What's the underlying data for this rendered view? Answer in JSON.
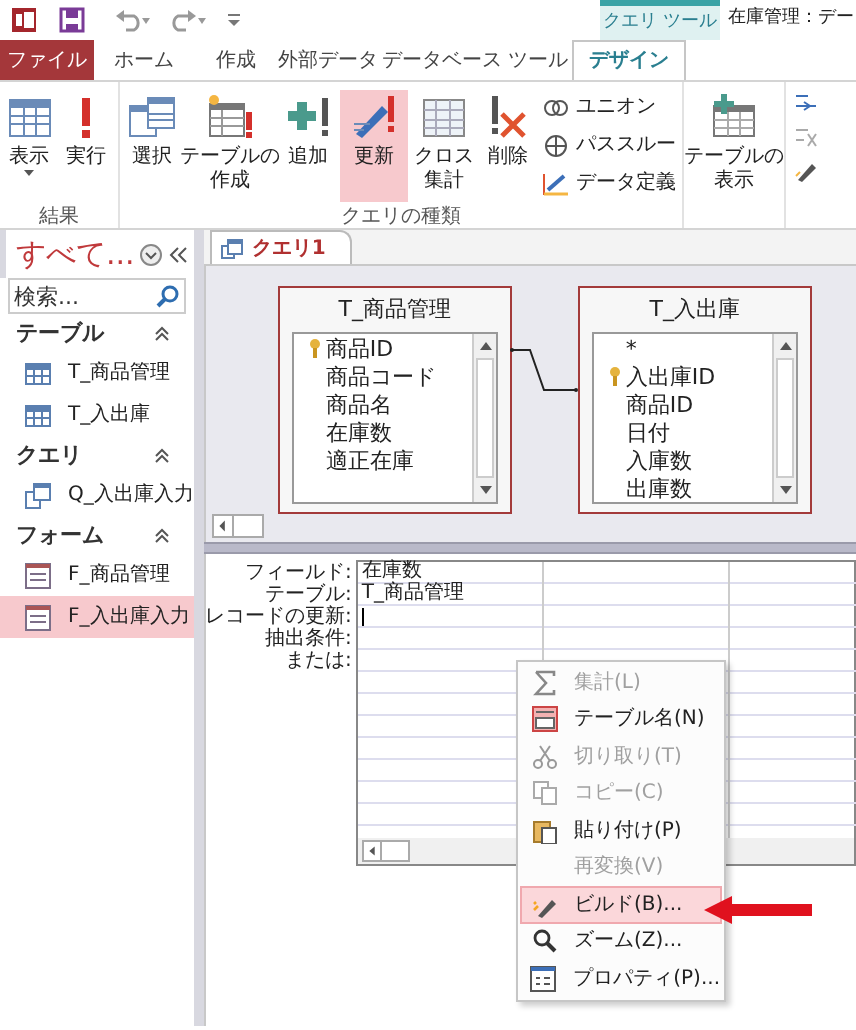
{
  "window": {
    "tool_tab": "クエリ ツール",
    "title": "在庫管理：デー"
  },
  "tabs": [
    {
      "label": "ファイル",
      "kind": "file",
      "selected": false
    },
    {
      "label": "ホーム",
      "kind": "tab",
      "selected": false
    },
    {
      "label": "作成",
      "kind": "tab",
      "selected": false
    },
    {
      "label": "外部データ",
      "kind": "tab",
      "selected": false
    },
    {
      "label": "データベース ツール",
      "kind": "tab",
      "selected": false
    },
    {
      "label": "デザイン",
      "kind": "tab",
      "selected": true
    }
  ],
  "ribbon": {
    "groups": [
      {
        "label": "結果",
        "buttons": [
          {
            "label": "表示",
            "kind": "big",
            "dropdown": true,
            "selected": false
          },
          {
            "label": "実行",
            "kind": "big",
            "selected": false
          }
        ]
      },
      {
        "label": "クエリの種類",
        "buttons": [
          {
            "label": "選択",
            "kind": "big",
            "selected": false
          },
          {
            "label": [
              "テーブルの",
              "作成"
            ],
            "kind": "big",
            "selected": false
          },
          {
            "label": "追加",
            "kind": "big",
            "selected": false
          },
          {
            "label": "更新",
            "kind": "big",
            "selected": true
          },
          {
            "label": [
              "クロス",
              "集計"
            ],
            "kind": "big",
            "selected": false
          },
          {
            "label": "削除",
            "kind": "big",
            "selected": false
          },
          {
            "label": "ユニオン",
            "kind": "small",
            "selected": false
          },
          {
            "label": "パススルー",
            "kind": "small",
            "selected": false
          },
          {
            "label": "データ定義",
            "kind": "small",
            "selected": false
          }
        ]
      },
      {
        "buttons": [
          {
            "label": [
              "テーブルの",
              "表示"
            ],
            "kind": "big",
            "selected": false
          }
        ]
      }
    ]
  },
  "navigation": {
    "title": "すべて...",
    "search": {
      "placeholder": "検索..."
    },
    "sections": [
      {
        "label": "テーブル",
        "expanded": true,
        "items": [
          {
            "label": "T_商品管理",
            "kind": "table",
            "selected": false
          },
          {
            "label": "T_入出庫",
            "kind": "table",
            "selected": false
          }
        ]
      },
      {
        "label": "クエリ",
        "expanded": true,
        "items": [
          {
            "label": "Q_入出庫入力",
            "kind": "query",
            "selected": false
          }
        ]
      },
      {
        "label": "フォーム",
        "expanded": true,
        "items": [
          {
            "label": "F_商品管理",
            "kind": "form",
            "selected": false
          },
          {
            "label": "F_入出庫入力",
            "kind": "form",
            "selected": true
          }
        ]
      }
    ]
  },
  "document_tab": {
    "label": "クエリ1"
  },
  "tables": [
    {
      "title": "T_商品管理",
      "fields": [
        {
          "name": "商品ID",
          "key": true
        },
        {
          "name": "商品コード",
          "key": false
        },
        {
          "name": "商品名",
          "key": false
        },
        {
          "name": "在庫数",
          "key": false
        },
        {
          "name": "適正在庫",
          "key": false
        }
      ]
    },
    {
      "title": "T_入出庫",
      "fields": [
        {
          "name": "*",
          "key": false
        },
        {
          "name": "入出庫ID",
          "key": true
        },
        {
          "name": "商品ID",
          "key": false
        },
        {
          "name": "日付",
          "key": false
        },
        {
          "name": "入庫数",
          "key": false
        },
        {
          "name": "出庫数",
          "key": false
        }
      ]
    }
  ],
  "grid": {
    "row_labels": [
      "フィールド:",
      "テーブル:",
      "レコードの更新:",
      "抽出条件:",
      "または:"
    ],
    "columns": [
      {
        "field": "在庫数",
        "table": "T_商品管理",
        "editing": true
      }
    ]
  },
  "context_menu": [
    {
      "label": "集計(L)",
      "disabled": true,
      "selected": false
    },
    {
      "label": "テーブル名(N)",
      "disabled": false,
      "selected": false
    },
    {
      "label": "切り取り(T)",
      "disabled": true,
      "selected": false
    },
    {
      "label": "コピー(C)",
      "disabled": true,
      "selected": false
    },
    {
      "label": "貼り付け(P)",
      "disabled": false,
      "selected": false
    },
    {
      "label": "再変換(V)",
      "disabled": true,
      "selected": false
    },
    {
      "label": "ビルド(B)...",
      "disabled": false,
      "selected": true
    },
    {
      "label": "ズーム(Z)...",
      "disabled": false,
      "selected": false
    },
    {
      "label": "プロパティ(P)...",
      "disabled": false,
      "selected": false
    }
  ]
}
